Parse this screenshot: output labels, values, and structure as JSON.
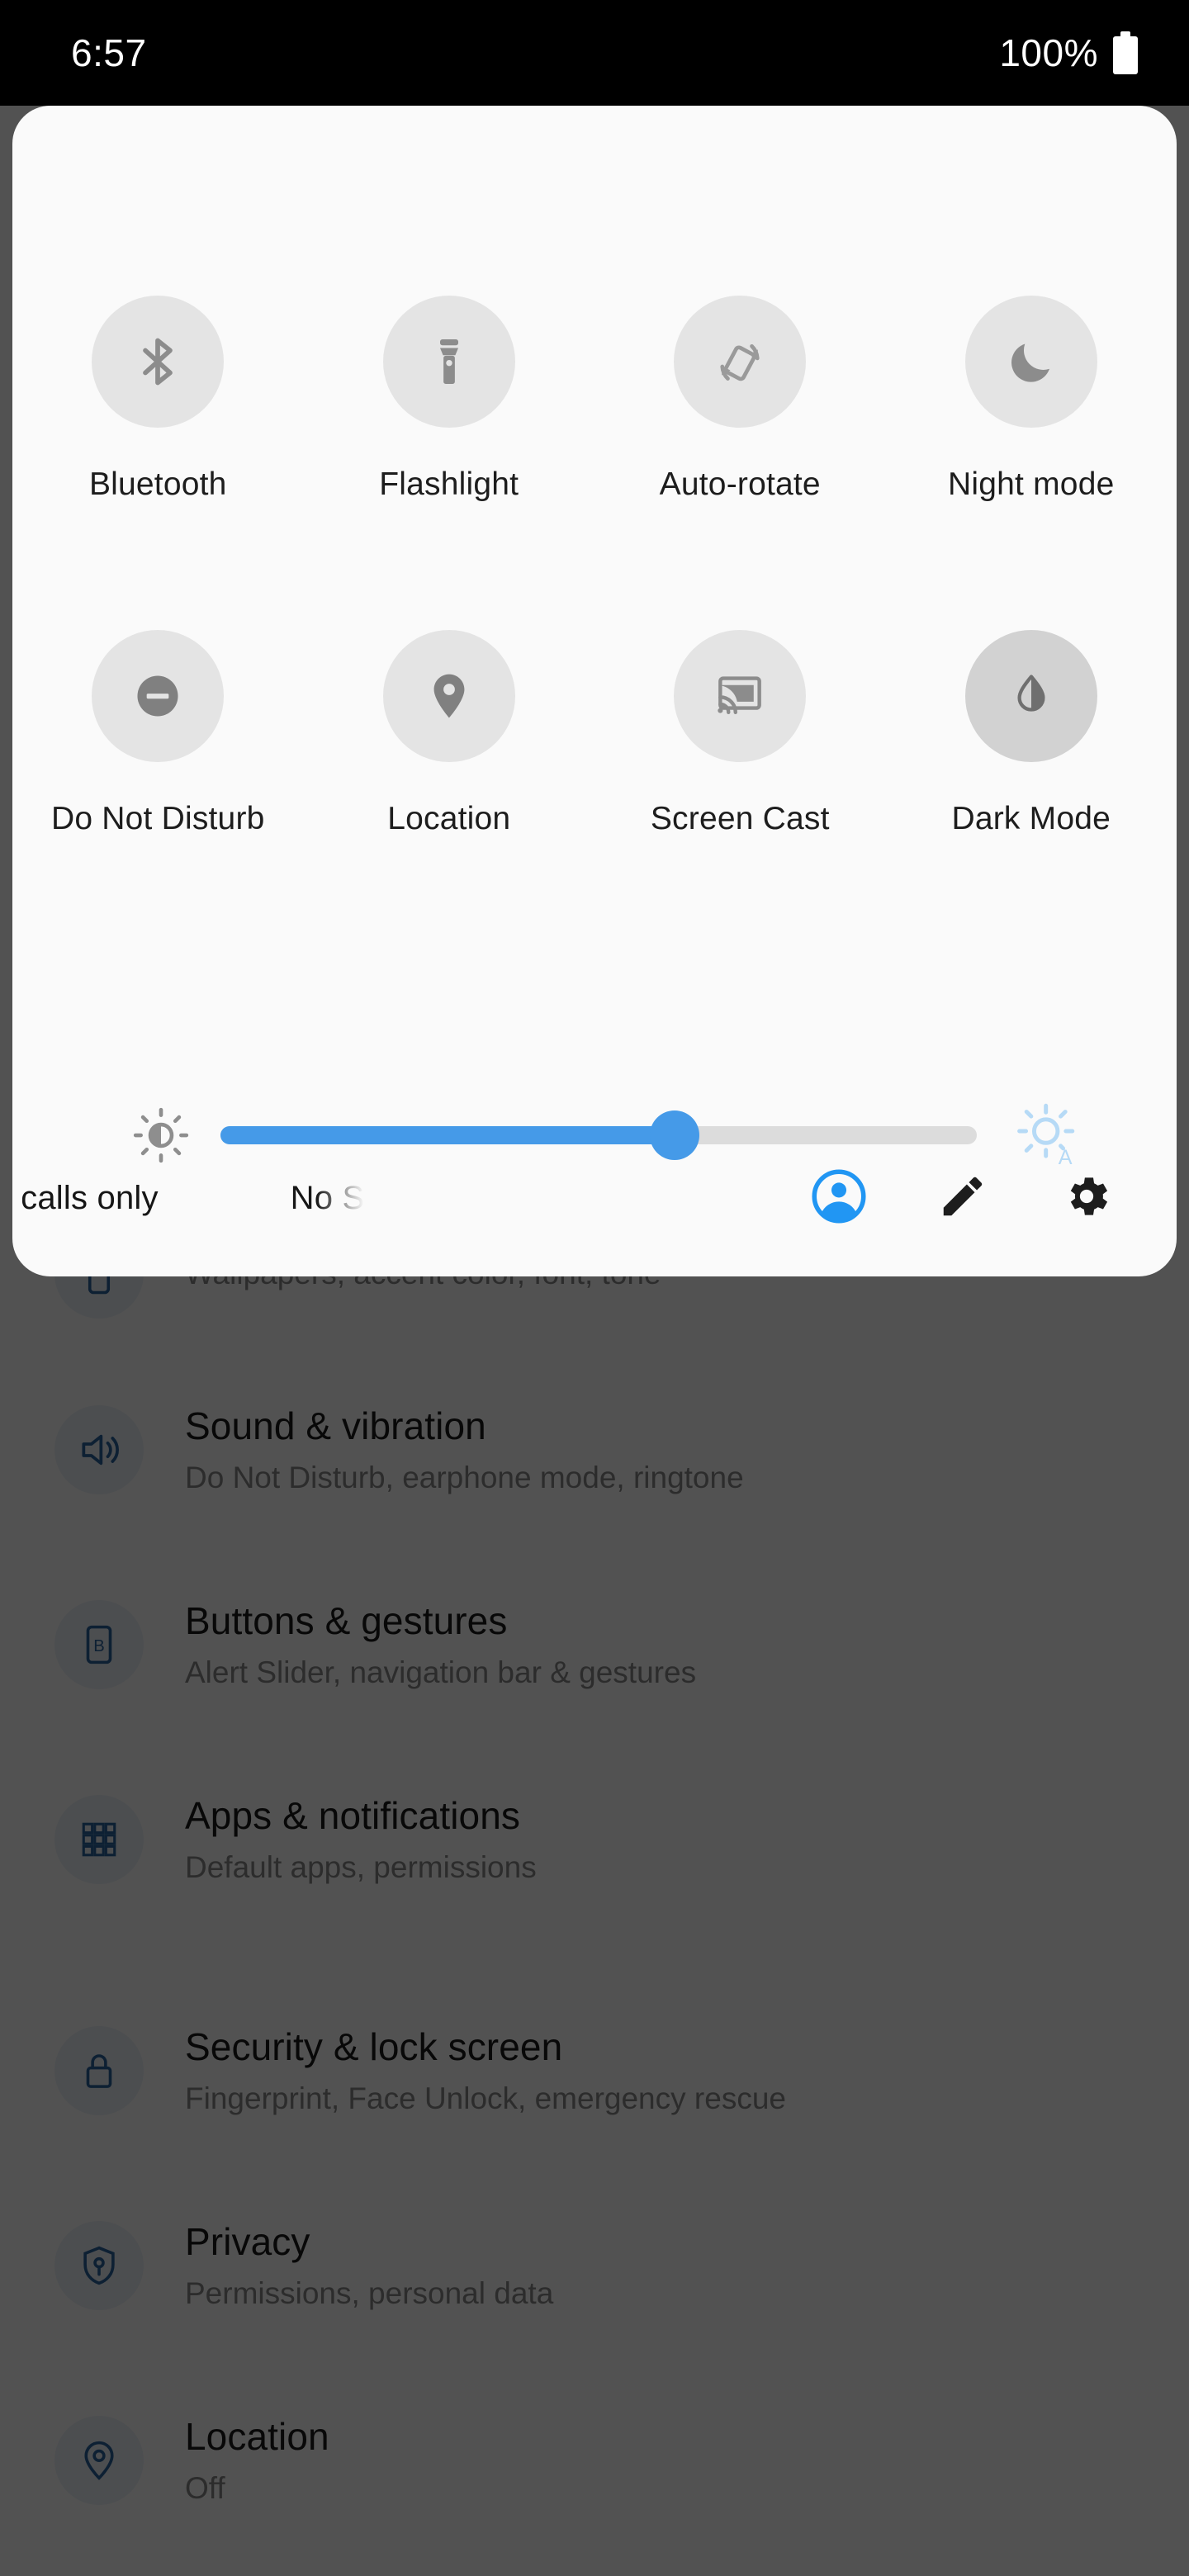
{
  "status_bar": {
    "clock": "6:57",
    "battery_percent": "100%",
    "battery_icon": "battery-full-icon"
  },
  "quick_settings": {
    "tiles": [
      {
        "label": "Bluetooth",
        "icon": "bluetooth-icon",
        "state": "off"
      },
      {
        "label": "Flashlight",
        "icon": "flashlight-icon",
        "state": "off"
      },
      {
        "label": "Auto-rotate",
        "icon": "auto-rotate-icon",
        "state": "off"
      },
      {
        "label": "Night mode",
        "icon": "moon-icon",
        "state": "off"
      },
      {
        "label": "Do Not Disturb",
        "icon": "minus-circle-icon",
        "state": "off"
      },
      {
        "label": "Location",
        "icon": "location-pin-icon",
        "state": "off"
      },
      {
        "label": "Screen Cast",
        "icon": "screen-cast-icon",
        "state": "off"
      },
      {
        "label": "Dark Mode",
        "icon": "contrast-drop-icon",
        "state": "on"
      }
    ],
    "brightness": {
      "low_icon": "brightness-low-icon",
      "auto_icon": "brightness-auto-icon",
      "value_percent": 60,
      "fill_color": "#459ae8",
      "track_color": "#dcdcdc"
    },
    "footer": {
      "carrier_text_primary": "ncy calls only",
      "carrier_text_secondary": "No S",
      "actions": [
        {
          "name": "user-account-icon",
          "color": "#2196f3"
        },
        {
          "name": "edit-pencil-icon",
          "color": "#1d1d1d"
        },
        {
          "name": "gear-icon",
          "color": "#1d1d1d"
        }
      ]
    }
  },
  "settings_background": {
    "rows": [
      {
        "title": "",
        "subtitle": "Wallpapers, accent color, font, tone",
        "icon": "customization-icon"
      },
      {
        "title": "Sound & vibration",
        "subtitle": "Do Not Disturb, earphone mode, ringtone",
        "icon": "volume-icon"
      },
      {
        "title": "Buttons & gestures",
        "subtitle": "Alert Slider, navigation bar & gestures",
        "icon": "buttons-icon"
      },
      {
        "title": "Apps & notifications",
        "subtitle": "Default apps, permissions",
        "icon": "apps-grid-icon"
      },
      {
        "title": "Security & lock screen",
        "subtitle": "Fingerprint, Face Unlock, emergency rescue",
        "icon": "lock-icon"
      },
      {
        "title": "Privacy",
        "subtitle": "Permissions, personal data",
        "icon": "shield-key-icon"
      },
      {
        "title": "Location",
        "subtitle": "Off",
        "icon": "location-target-icon"
      }
    ]
  }
}
